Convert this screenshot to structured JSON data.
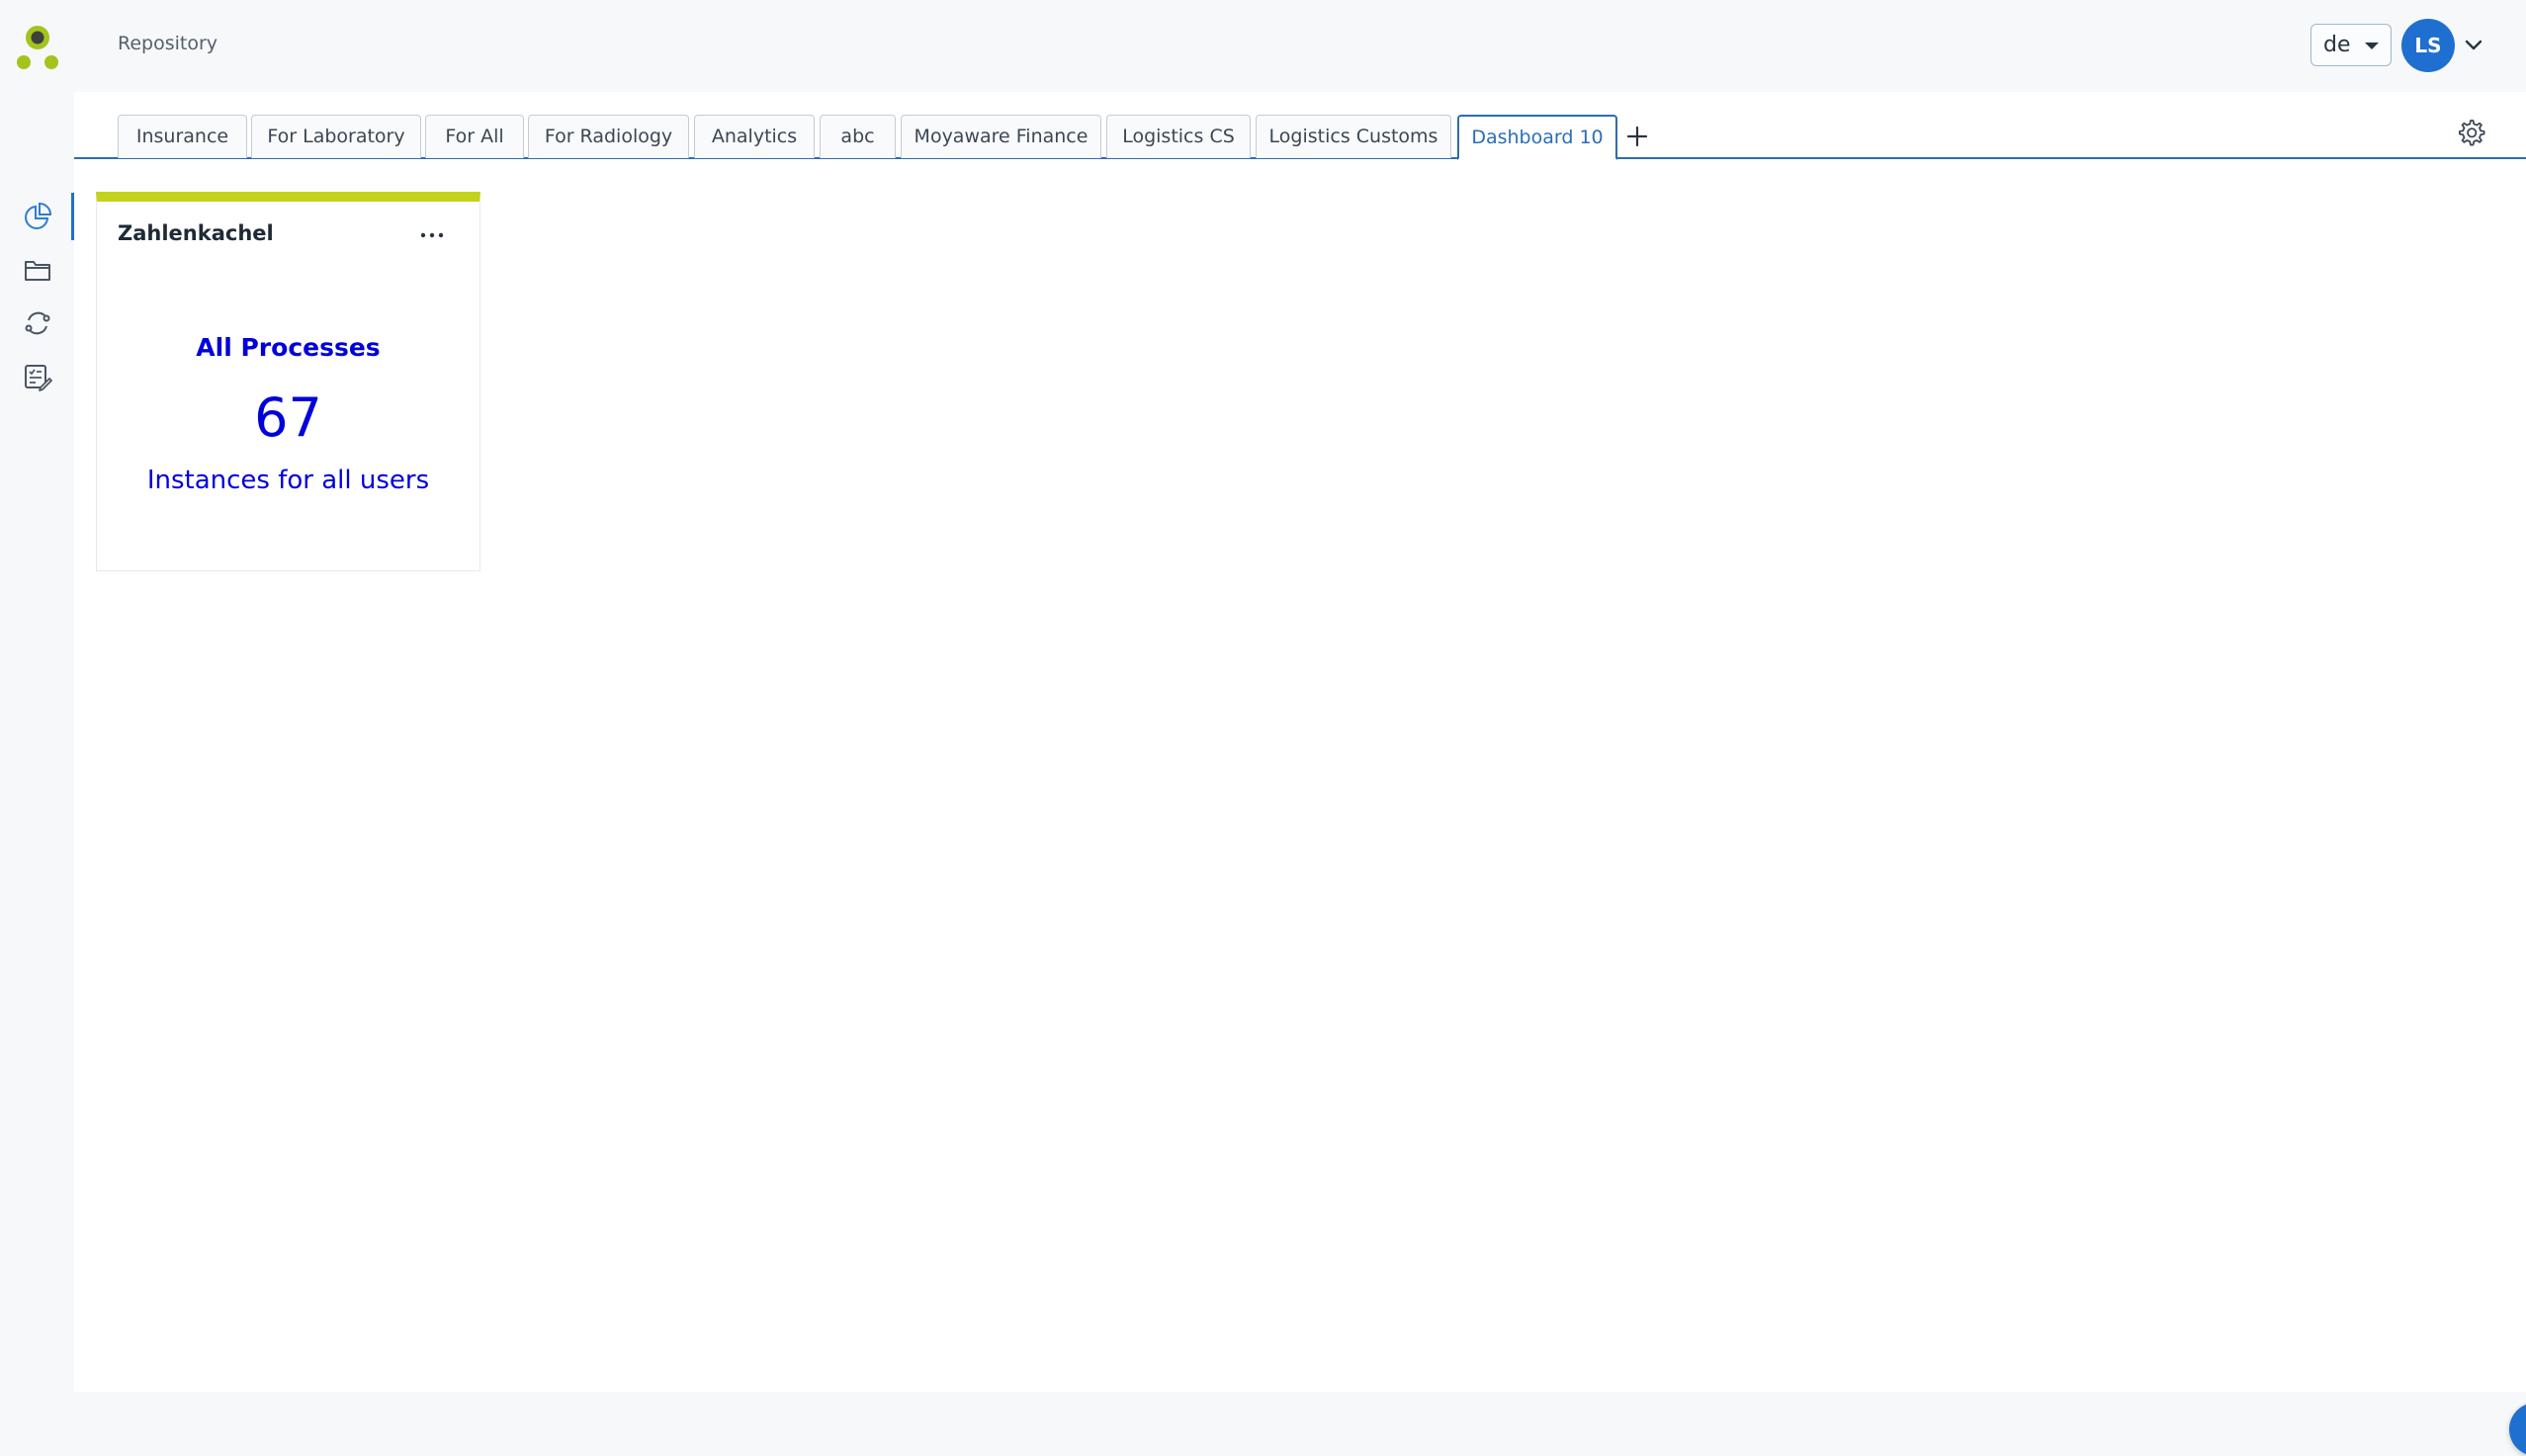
{
  "header": {
    "breadcrumb": "Repository",
    "language": "de",
    "user_initials": "LS"
  },
  "sidebar": {
    "items": [
      {
        "icon": "dashboard-chart-icon",
        "active": true
      },
      {
        "icon": "folder-icon",
        "active": false
      },
      {
        "icon": "process-cycle-icon",
        "active": false
      },
      {
        "icon": "task-checklist-icon",
        "active": false
      }
    ]
  },
  "tabs": {
    "items": [
      {
        "label": "Insurance"
      },
      {
        "label": "For Laboratory"
      },
      {
        "label": "For All"
      },
      {
        "label": "For Radiology"
      },
      {
        "label": "Analytics"
      },
      {
        "label": "abc"
      },
      {
        "label": "Moyaware Finance"
      },
      {
        "label": "Logistics CS"
      },
      {
        "label": "Logistics Customs"
      },
      {
        "label": "Dashboard 10"
      }
    ],
    "active_index": 9
  },
  "tile": {
    "title": "Zahlenkachel",
    "heading": "All Processes",
    "value": "67",
    "subtitle": "Instances for all users",
    "accent_color": "#c3d31b",
    "text_color": "#0000d9"
  },
  "colors": {
    "primary": "#1f6fd1",
    "logo_dark": "#3f3f3f",
    "logo_green": "#a3c41c"
  }
}
